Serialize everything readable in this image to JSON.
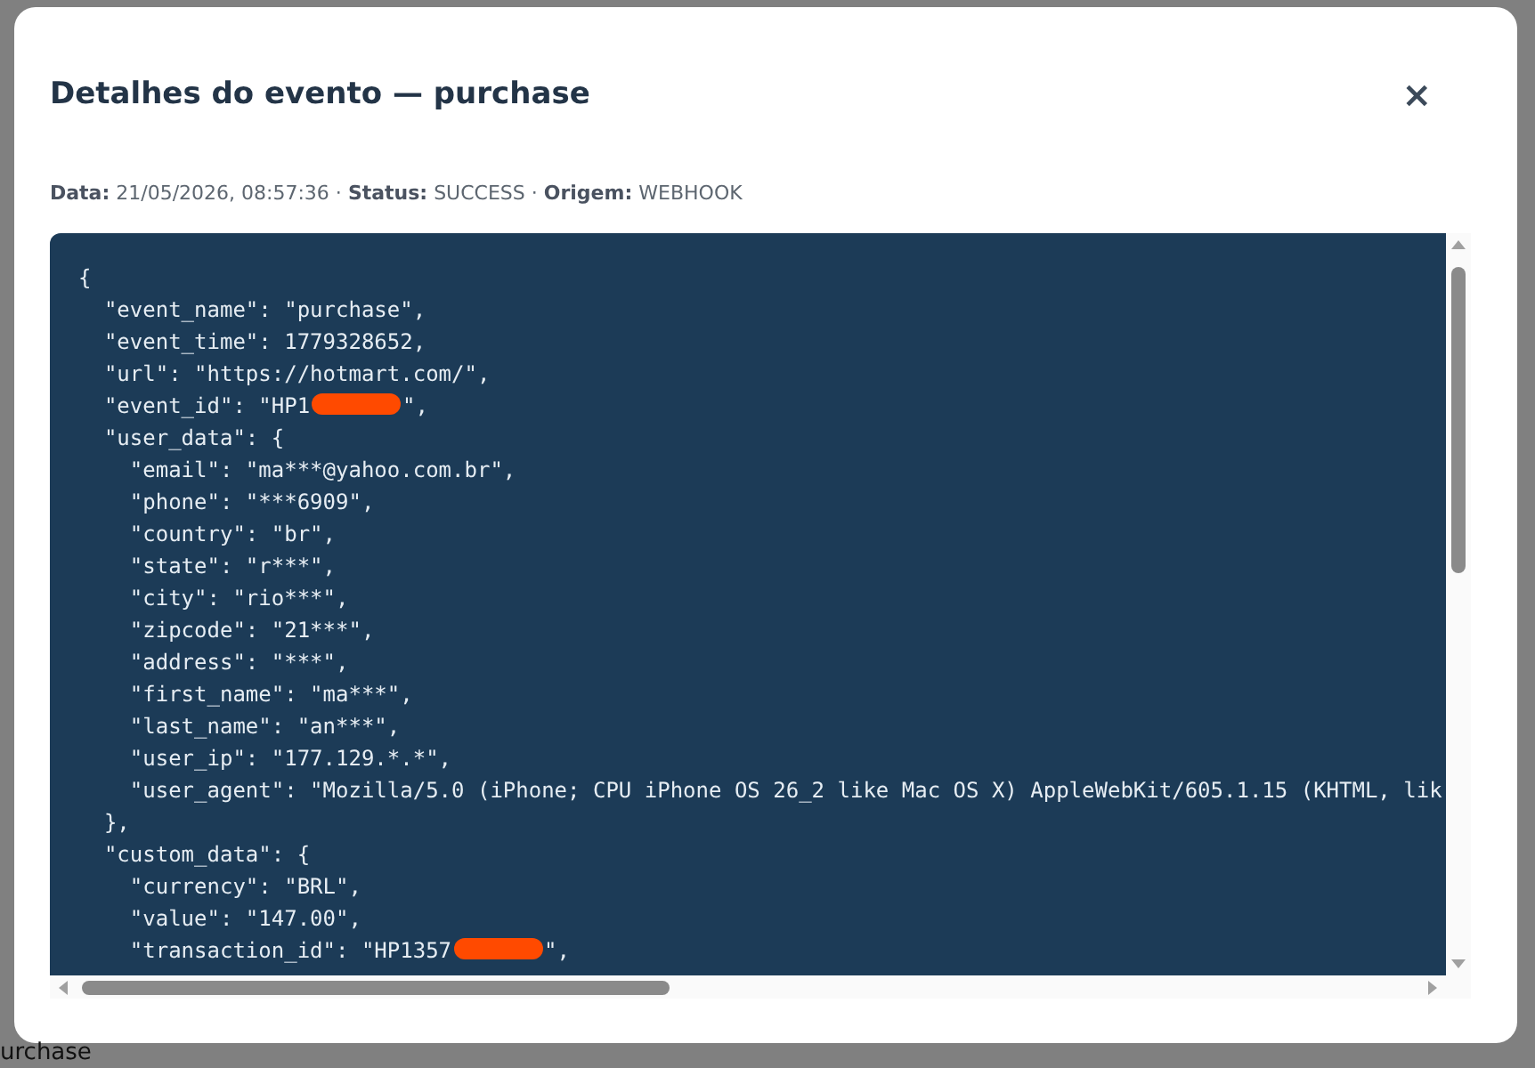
{
  "modal": {
    "title": "Detalhes do evento — purchase",
    "close": "×",
    "meta_separator": "·",
    "meta": [
      {
        "label": "Data:",
        "value": "21/05/2026, 08:57:36"
      },
      {
        "label": "Status:",
        "value": "SUCCESS"
      },
      {
        "label": "Origem:",
        "value": "WEBHOOK"
      }
    ],
    "code_lines": [
      {
        "text": "{"
      },
      {
        "text": "  \"event_name\": \"purchase\","
      },
      {
        "text": "  \"event_time\": 1779328652,"
      },
      {
        "text": "  \"url\": \"https://hotmart.com/\","
      },
      {
        "text": "  \"event_id\": \"HP1",
        "redacted": true,
        "after": "\","
      },
      {
        "text": "  \"user_data\": {"
      },
      {
        "text": "    \"email\": \"ma***@yahoo.com.br\","
      },
      {
        "text": "    \"phone\": \"***6909\","
      },
      {
        "text": "    \"country\": \"br\","
      },
      {
        "text": "    \"state\": \"r***\","
      },
      {
        "text": "    \"city\": \"rio***\","
      },
      {
        "text": "    \"zipcode\": \"21***\","
      },
      {
        "text": "    \"address\": \"***\","
      },
      {
        "text": "    \"first_name\": \"ma***\","
      },
      {
        "text": "    \"last_name\": \"an***\","
      },
      {
        "text": "    \"user_ip\": \"177.129.*.*\","
      },
      {
        "text": "    \"user_agent\": \"Mozilla/5.0 (iPhone; CPU iPhone OS 26_2 like Mac OS X) AppleWebKit/605.1.15 (KHTML, lik"
      },
      {
        "text": "  },"
      },
      {
        "text": "  \"custom_data\": {"
      },
      {
        "text": "    \"currency\": \"BRL\","
      },
      {
        "text": "    \"value\": \"147.00\","
      },
      {
        "text": "    \"transaction_id\": \"HP1357",
        "redacted": true,
        "after": "\","
      }
    ]
  },
  "background": {
    "text": "urchase"
  }
}
